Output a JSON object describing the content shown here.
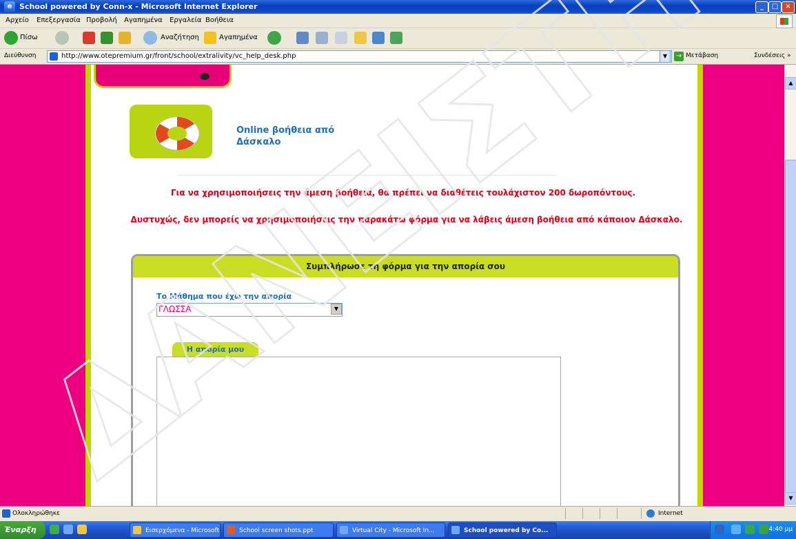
{
  "window": {
    "title": "School powered by Conn-x - Microsoft Internet Explorer",
    "controls": {
      "minimize": "_",
      "maximize": "□",
      "close": "×"
    }
  },
  "menu": [
    "Αρχείο",
    "Επεξεργασία",
    "Προβολή",
    "Αγαπημένα",
    "Εργαλεία",
    "Βοήθεια"
  ],
  "toolbar": {
    "back_label": "Πίσω",
    "search_label": "Αναζήτηση",
    "favorites_label": "Αγαπημένα"
  },
  "address": {
    "label": "Διεύθυνση",
    "url": "http://www.otepremium.gr/front/school/extralivity/vc_help_desk.php",
    "go_label": "Μετάβαση",
    "links_label": "Συνδέσεις »"
  },
  "page": {
    "help_title_line1": "Online βοήθεια από",
    "help_title_line2": "Δάσκαλο",
    "message1": "Για να χρησιμοποιήσεις την άμεση βοήθεια, θα πρέπει να διαθέτεις τουλάχιστον 200 δωροπόντους.",
    "message2": "Δυστυχώς, δεν μπορείς να χρησιμοποιήσεις την παρακάτω φόρμα για να λάβεις άμεση βοήθεια από κάποιον Δάσκαλο.",
    "form": {
      "header": "Συμπλήρωσε τη φόρμα για την απορία σου",
      "subject_label": "Το Μάθημα που έχω την απορία",
      "subject_value": "ΓΛΩΣΣΑ",
      "problem_tab": "Η απορία μου",
      "problem_value": ""
    }
  },
  "status": {
    "text": "Ολοκληρώθηκε",
    "zone": "Internet"
  },
  "taskbar": {
    "start_label": "Έναρξη",
    "tasks": [
      "Εισερχόμενα - Microsoft ...",
      "School screen shots.ppt",
      "Virtual City - Microsoft In...",
      "School powered by Co..."
    ],
    "clock": "4:40 μμ"
  },
  "watermark_text": "ΔΑΝΕΙΣΤΗ",
  "colors": {
    "magenta": "#ec0080",
    "lime": "#c2d600",
    "form_header": "#c9de22",
    "alert_red": "#e0001b",
    "link_blue": "#1d6fb8"
  }
}
